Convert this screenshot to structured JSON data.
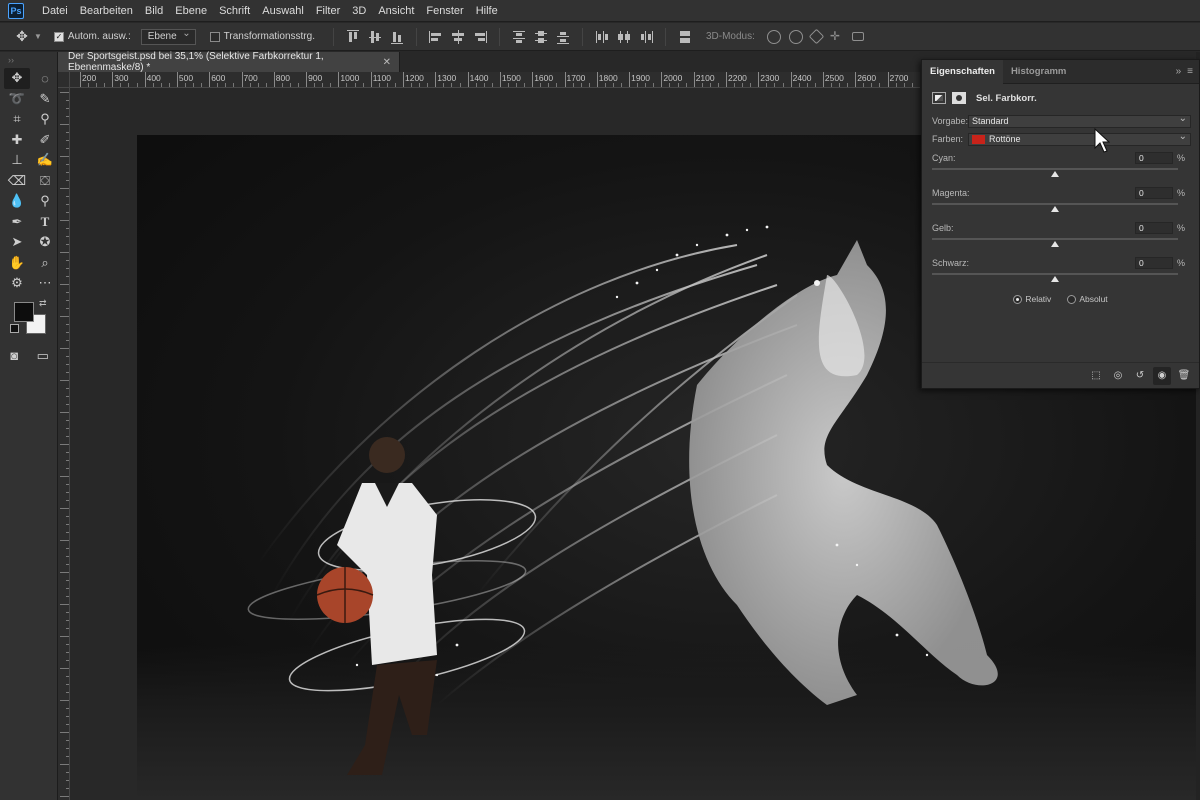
{
  "app": {
    "logo_text": "Ps"
  },
  "menu": [
    "Datei",
    "Bearbeiten",
    "Bild",
    "Ebene",
    "Schrift",
    "Auswahl",
    "Filter",
    "3D",
    "Ansicht",
    "Fenster",
    "Hilfe"
  ],
  "options": {
    "auto_select_label": "Autom. ausw.:",
    "auto_select_checked": true,
    "auto_select_target": "Ebene",
    "transform_label": "Transformationsstrg.",
    "transform_checked": false,
    "mode_3d_label": "3D-Modus:"
  },
  "document": {
    "tab_title": "Der Sportsgeist.psd bei 35,1% (Selektive Farbkorrektur 1, Ebenenmaske/8) *",
    "ruler_labels": [
      "200",
      "300",
      "400",
      "500",
      "600",
      "700",
      "800",
      "900",
      "1000",
      "1100",
      "1200",
      "1300",
      "1400",
      "1500",
      "1600",
      "1700",
      "1800",
      "1900",
      "2000",
      "2100",
      "2200",
      "2300",
      "2400",
      "2500",
      "2600",
      "2700"
    ]
  },
  "panel": {
    "tabs": [
      {
        "label": "Eigenschaften",
        "active": true
      },
      {
        "label": "Histogramm",
        "active": false
      }
    ],
    "title": "Sel. Farbkorr.",
    "preset_label": "Vorgabe:",
    "preset_value": "Standard",
    "colors_label": "Farben:",
    "colors_value": "Rottöne",
    "colors_chip": "#c8231a",
    "sliders": [
      {
        "label": "Cyan:",
        "value": "0",
        "unit": "%",
        "position": 0.5
      },
      {
        "label": "Magenta:",
        "value": "0",
        "unit": "%",
        "position": 0.5
      },
      {
        "label": "Gelb:",
        "value": "0",
        "unit": "%",
        "position": 0.5
      },
      {
        "label": "Schwarz:",
        "value": "0",
        "unit": "%",
        "position": 0.5
      }
    ],
    "method_relative": "Relativ",
    "method_absolute": "Absolut",
    "method_selected": "Relativ"
  },
  "colors": {
    "foreground": "#0d0d0d",
    "background": "#f2f2f2"
  }
}
